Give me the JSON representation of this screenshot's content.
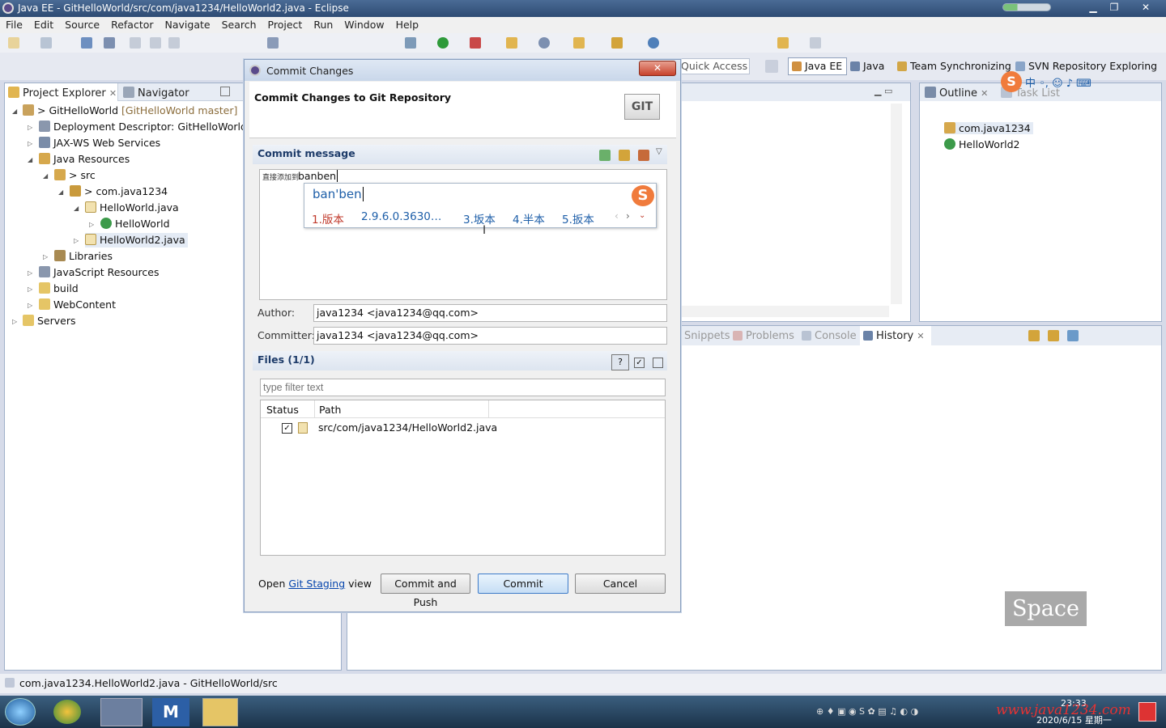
{
  "window": {
    "title": "Java EE - GitHelloWorld/src/com/java1234/HelloWorld2.java - Eclipse"
  },
  "menu": [
    "File",
    "Edit",
    "Source",
    "Refactor",
    "Navigate",
    "Search",
    "Project",
    "Run",
    "Window",
    "Help"
  ],
  "perspectives": {
    "quick_access": "Quick Access",
    "items": [
      "Java EE",
      "Java",
      "Team Synchronizing",
      "SVN Repository Exploring"
    ]
  },
  "left_panel": {
    "tabs": [
      "Project Explorer",
      "Navigator"
    ],
    "tree": [
      {
        "label": "> GitHelloWorld",
        "suffix": "[GitHelloWorld master]"
      },
      {
        "label": "Deployment Descriptor: GitHelloWorld"
      },
      {
        "label": "JAX-WS Web Services"
      },
      {
        "label": "Java Resources"
      },
      {
        "label": "> src"
      },
      {
        "label": "> com.java1234"
      },
      {
        "label": "HelloWorld.java"
      },
      {
        "label": "HelloWorld"
      },
      {
        "label": "HelloWorld2.java"
      },
      {
        "label": "Libraries"
      },
      {
        "label": "JavaScript Resources"
      },
      {
        "label": "build"
      },
      {
        "label": "WebContent"
      },
      {
        "label": "Servers"
      }
    ]
  },
  "outline": {
    "tabs": [
      "Outline",
      "Task List"
    ],
    "items": [
      "com.java1234",
      "HelloWorld2"
    ]
  },
  "bottom_tabs": [
    "Snippets",
    "Problems",
    "Console",
    "History"
  ],
  "dialog": {
    "title": "Commit Changes",
    "heading": "Commit Changes to Git Repository",
    "git_logo": "GIT",
    "commit_message_label": "Commit message",
    "commit_message_prefix": "直接添加到",
    "commit_message_typed": "banben",
    "author_label": "Author:",
    "author_value": "java1234 <java1234@qq.com>",
    "committer_label": "Committer:",
    "committer_value": "java1234 <java1234@qq.com>",
    "files_label": "Files (1/1)",
    "filter_placeholder": "type filter text",
    "columns": [
      "Status",
      "Path"
    ],
    "files": [
      {
        "checked": true,
        "path": "src/com/java1234/HelloWorld2.java"
      }
    ],
    "open_label": "Open",
    "git_staging_link": "Git Staging",
    "view_label": "view",
    "buttons": {
      "commit_and_push": "Commit and Push",
      "commit": "Commit",
      "cancel": "Cancel"
    }
  },
  "ime": {
    "pinyin": "ban'ben",
    "candidates": [
      "1.版本",
      "2.9.6.0.3630…",
      "3.坂本",
      "4.半本",
      "5.扳本"
    ]
  },
  "overlay": {
    "space_key": "Space"
  },
  "status_bar": {
    "text": "com.java1234.HelloWorld2.java - GitHelloWorld/src"
  },
  "taskbar": {
    "time": "23:33",
    "date": "2020/6/15 星期一",
    "watermark": "www.java1234.com"
  },
  "colors": {
    "accent": "#1d3b69",
    "link": "#0645ad",
    "ime_candidate": "#c0392b"
  }
}
